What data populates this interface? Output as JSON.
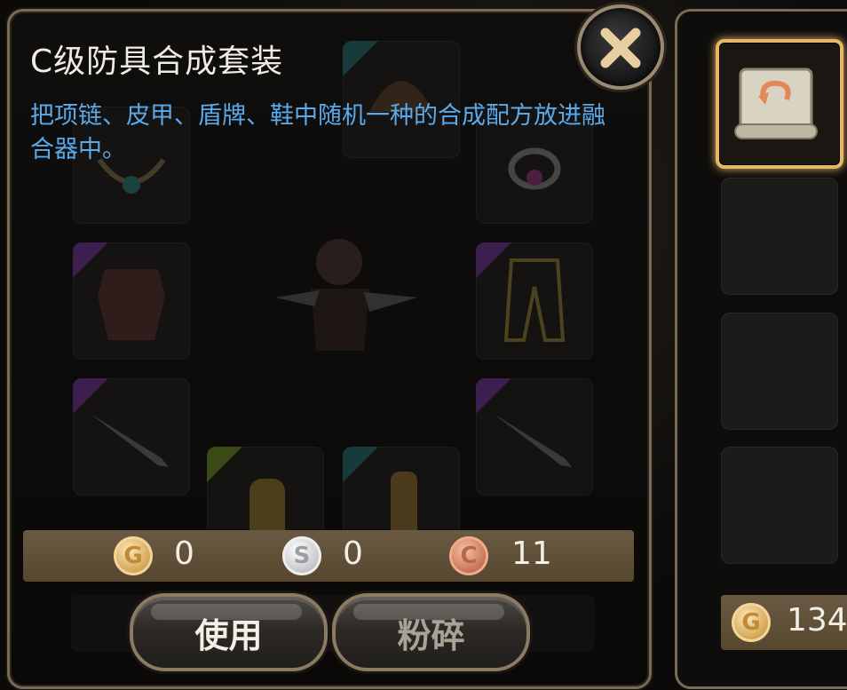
{
  "panel": {
    "title": "C级防具合成套装",
    "description": "把项链、皮甲、盾牌、鞋中随机一种的合成配方放进融合器中。"
  },
  "slots": [
    {
      "name": "amulet-slot",
      "icon": "amulet-icon",
      "rarity": "none"
    },
    {
      "name": "helmet-slot",
      "icon": "helmet-icon",
      "rarity": "cyan"
    },
    {
      "name": "ring-slot",
      "icon": "ring-icon",
      "rarity": "none"
    },
    {
      "name": "armor-slot",
      "icon": "armor-icon",
      "rarity": "purple"
    },
    {
      "name": "leggings-slot",
      "icon": "leggings-icon",
      "rarity": "purple"
    },
    {
      "name": "sword-left-slot",
      "icon": "sword-icon",
      "rarity": "purple"
    },
    {
      "name": "sword-right-slot",
      "icon": "sword-icon",
      "rarity": "purple"
    },
    {
      "name": "gloves-slot",
      "icon": "gloves-icon",
      "rarity": "lime"
    },
    {
      "name": "boots-slot",
      "icon": "boots-icon",
      "rarity": "cyan"
    }
  ],
  "currency": {
    "gold": {
      "icon": "gold-coin-icon",
      "letter": "G",
      "value": "0"
    },
    "silver": {
      "icon": "silver-coin-icon",
      "letter": "S",
      "value": "0"
    },
    "copper": {
      "icon": "copper-coin-icon",
      "letter": "C",
      "value": "11"
    }
  },
  "buttons": {
    "use": "使用",
    "smash": "粉碎"
  },
  "right_panel": {
    "selected_item_icon": "scroll-icon",
    "gold": {
      "letter": "G",
      "value": "134"
    }
  },
  "colors": {
    "accent_blue": "#5aa9ea",
    "selected_border": "#e7b765",
    "panel_border": "#7a6a55"
  }
}
